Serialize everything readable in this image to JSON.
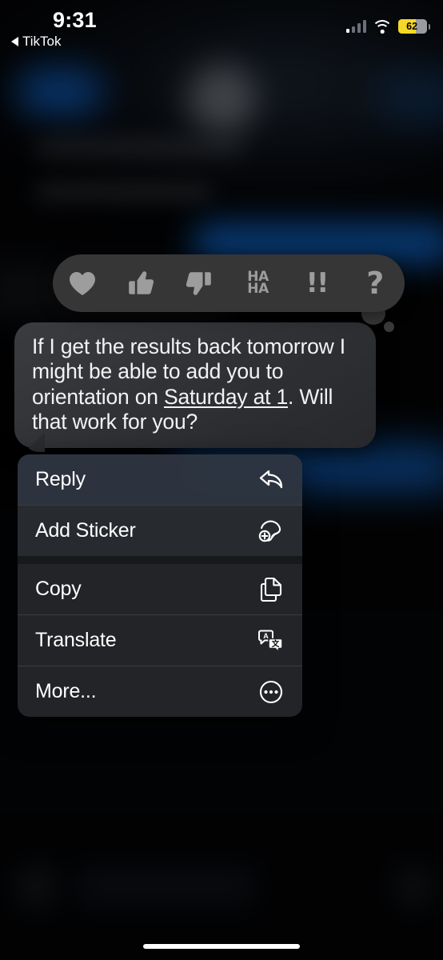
{
  "status_bar": {
    "time": "9:31",
    "back_app_label": "TikTok",
    "back_icon": "triangle-left-icon",
    "cellular_icon": "signal-bars-icon",
    "wifi_icon": "wifi-icon",
    "battery_percent": "62",
    "battery_level": 62,
    "battery_color": "#f6d928",
    "battery_icon": "battery-low-power-icon"
  },
  "tapback": {
    "options": [
      {
        "name": "heart-reaction",
        "icon": "heart-icon",
        "label": "Love"
      },
      {
        "name": "thumbsup-reaction",
        "icon": "thumbs-up-icon",
        "label": "Like"
      },
      {
        "name": "thumbsdown-reaction",
        "icon": "thumbs-down-icon",
        "label": "Dislike"
      },
      {
        "name": "haha-reaction",
        "icon": "haha-icon",
        "line1": "HA",
        "line2": "HA"
      },
      {
        "name": "exclamation-reaction",
        "icon": "double-exclamation-icon",
        "glyph": "!!"
      },
      {
        "name": "question-reaction",
        "icon": "question-mark-icon",
        "glyph": "?"
      }
    ],
    "background_color": "#363636",
    "icon_color": "#9d9d9d"
  },
  "message": {
    "sender": "incoming",
    "text_part_1": "If I get the results back tomorrow I might be able to add you to orientation on ",
    "text_link": "Saturday at 1",
    "text_part_2": ". Will that work for you?",
    "bubble_color": "#303236"
  },
  "context_menu": {
    "items": [
      {
        "label": "Reply",
        "icon": "reply-arrow-icon",
        "name": "menu-item-reply"
      },
      {
        "label": "Add Sticker",
        "icon": "add-sticker-icon",
        "name": "menu-item-add-sticker"
      },
      {
        "label": "Copy",
        "icon": "copy-documents-icon",
        "name": "menu-item-copy"
      },
      {
        "label": "Translate",
        "icon": "translate-bubbles-icon",
        "name": "menu-item-translate"
      },
      {
        "label": "More...",
        "icon": "ellipsis-circle-icon",
        "name": "menu-item-more"
      }
    ]
  },
  "home_indicator": {
    "name": "home-indicator"
  }
}
